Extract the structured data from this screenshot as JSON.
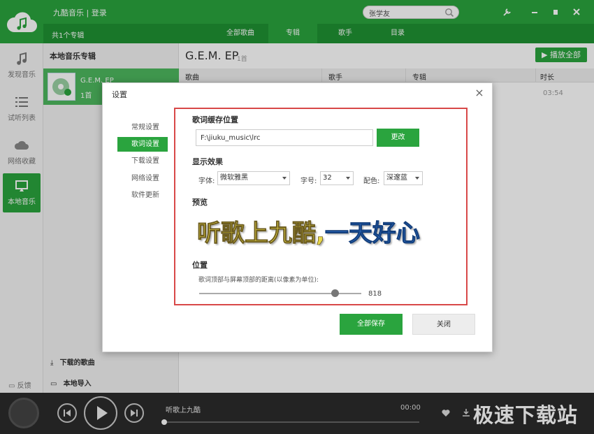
{
  "app": {
    "title": "九酷音乐 | 登录"
  },
  "search": {
    "value": "张学友"
  },
  "subbar": {
    "album_count": "共1个专辑",
    "tabs": [
      "全部歌曲",
      "专辑",
      "歌手",
      "目录"
    ]
  },
  "leftnav": {
    "items": [
      "发现音乐",
      "试听列表",
      "网络收藏",
      "本地音乐"
    ],
    "feedback": "反馈"
  },
  "albums": {
    "title": "本地音乐专辑",
    "album_name": "G.E.M. EP",
    "album_tracks": "1首",
    "downloaded": "下载的歌曲",
    "local_import": "本地导入"
  },
  "main": {
    "title": "G.E.M. EP",
    "count": "1首",
    "play_all": "▶ 播放全部",
    "columns": [
      "歌曲",
      "歌手",
      "专辑",
      "时长"
    ],
    "track_duration": "03:54"
  },
  "player": {
    "song": "听歌上九酷",
    "time": "00:00",
    "progress": 0
  },
  "watermark": "极速下载站",
  "dialog": {
    "title": "设置",
    "close_glyph": "×",
    "menu": [
      "常规设置",
      "歌词设置",
      "下载设置",
      "网络设置",
      "软件更新"
    ],
    "selected_menu": "歌词设置",
    "cache_title": "歌词缓存位置",
    "cache_path": "F:\\jiuku_music\\lrc",
    "change_label": "更改",
    "display_title": "显示效果",
    "font_label": "字体:",
    "font_value": "微软雅黑",
    "size_label": "字号:",
    "size_value": "32",
    "color_label": "配色:",
    "color_value": "深邃蓝",
    "preview_title": "预览",
    "preview_yellow": "听歌上九酷,",
    "preview_blue": "一天好心",
    "position_title": "位置",
    "position_desc": "歌词顶部与屏幕顶部的距离(以像素为单位):",
    "position_value": "818",
    "save_all_label": "全部保存",
    "close_label": "关闭"
  },
  "colors": {
    "accent": "#2aa43e",
    "frame": "#d84848"
  }
}
